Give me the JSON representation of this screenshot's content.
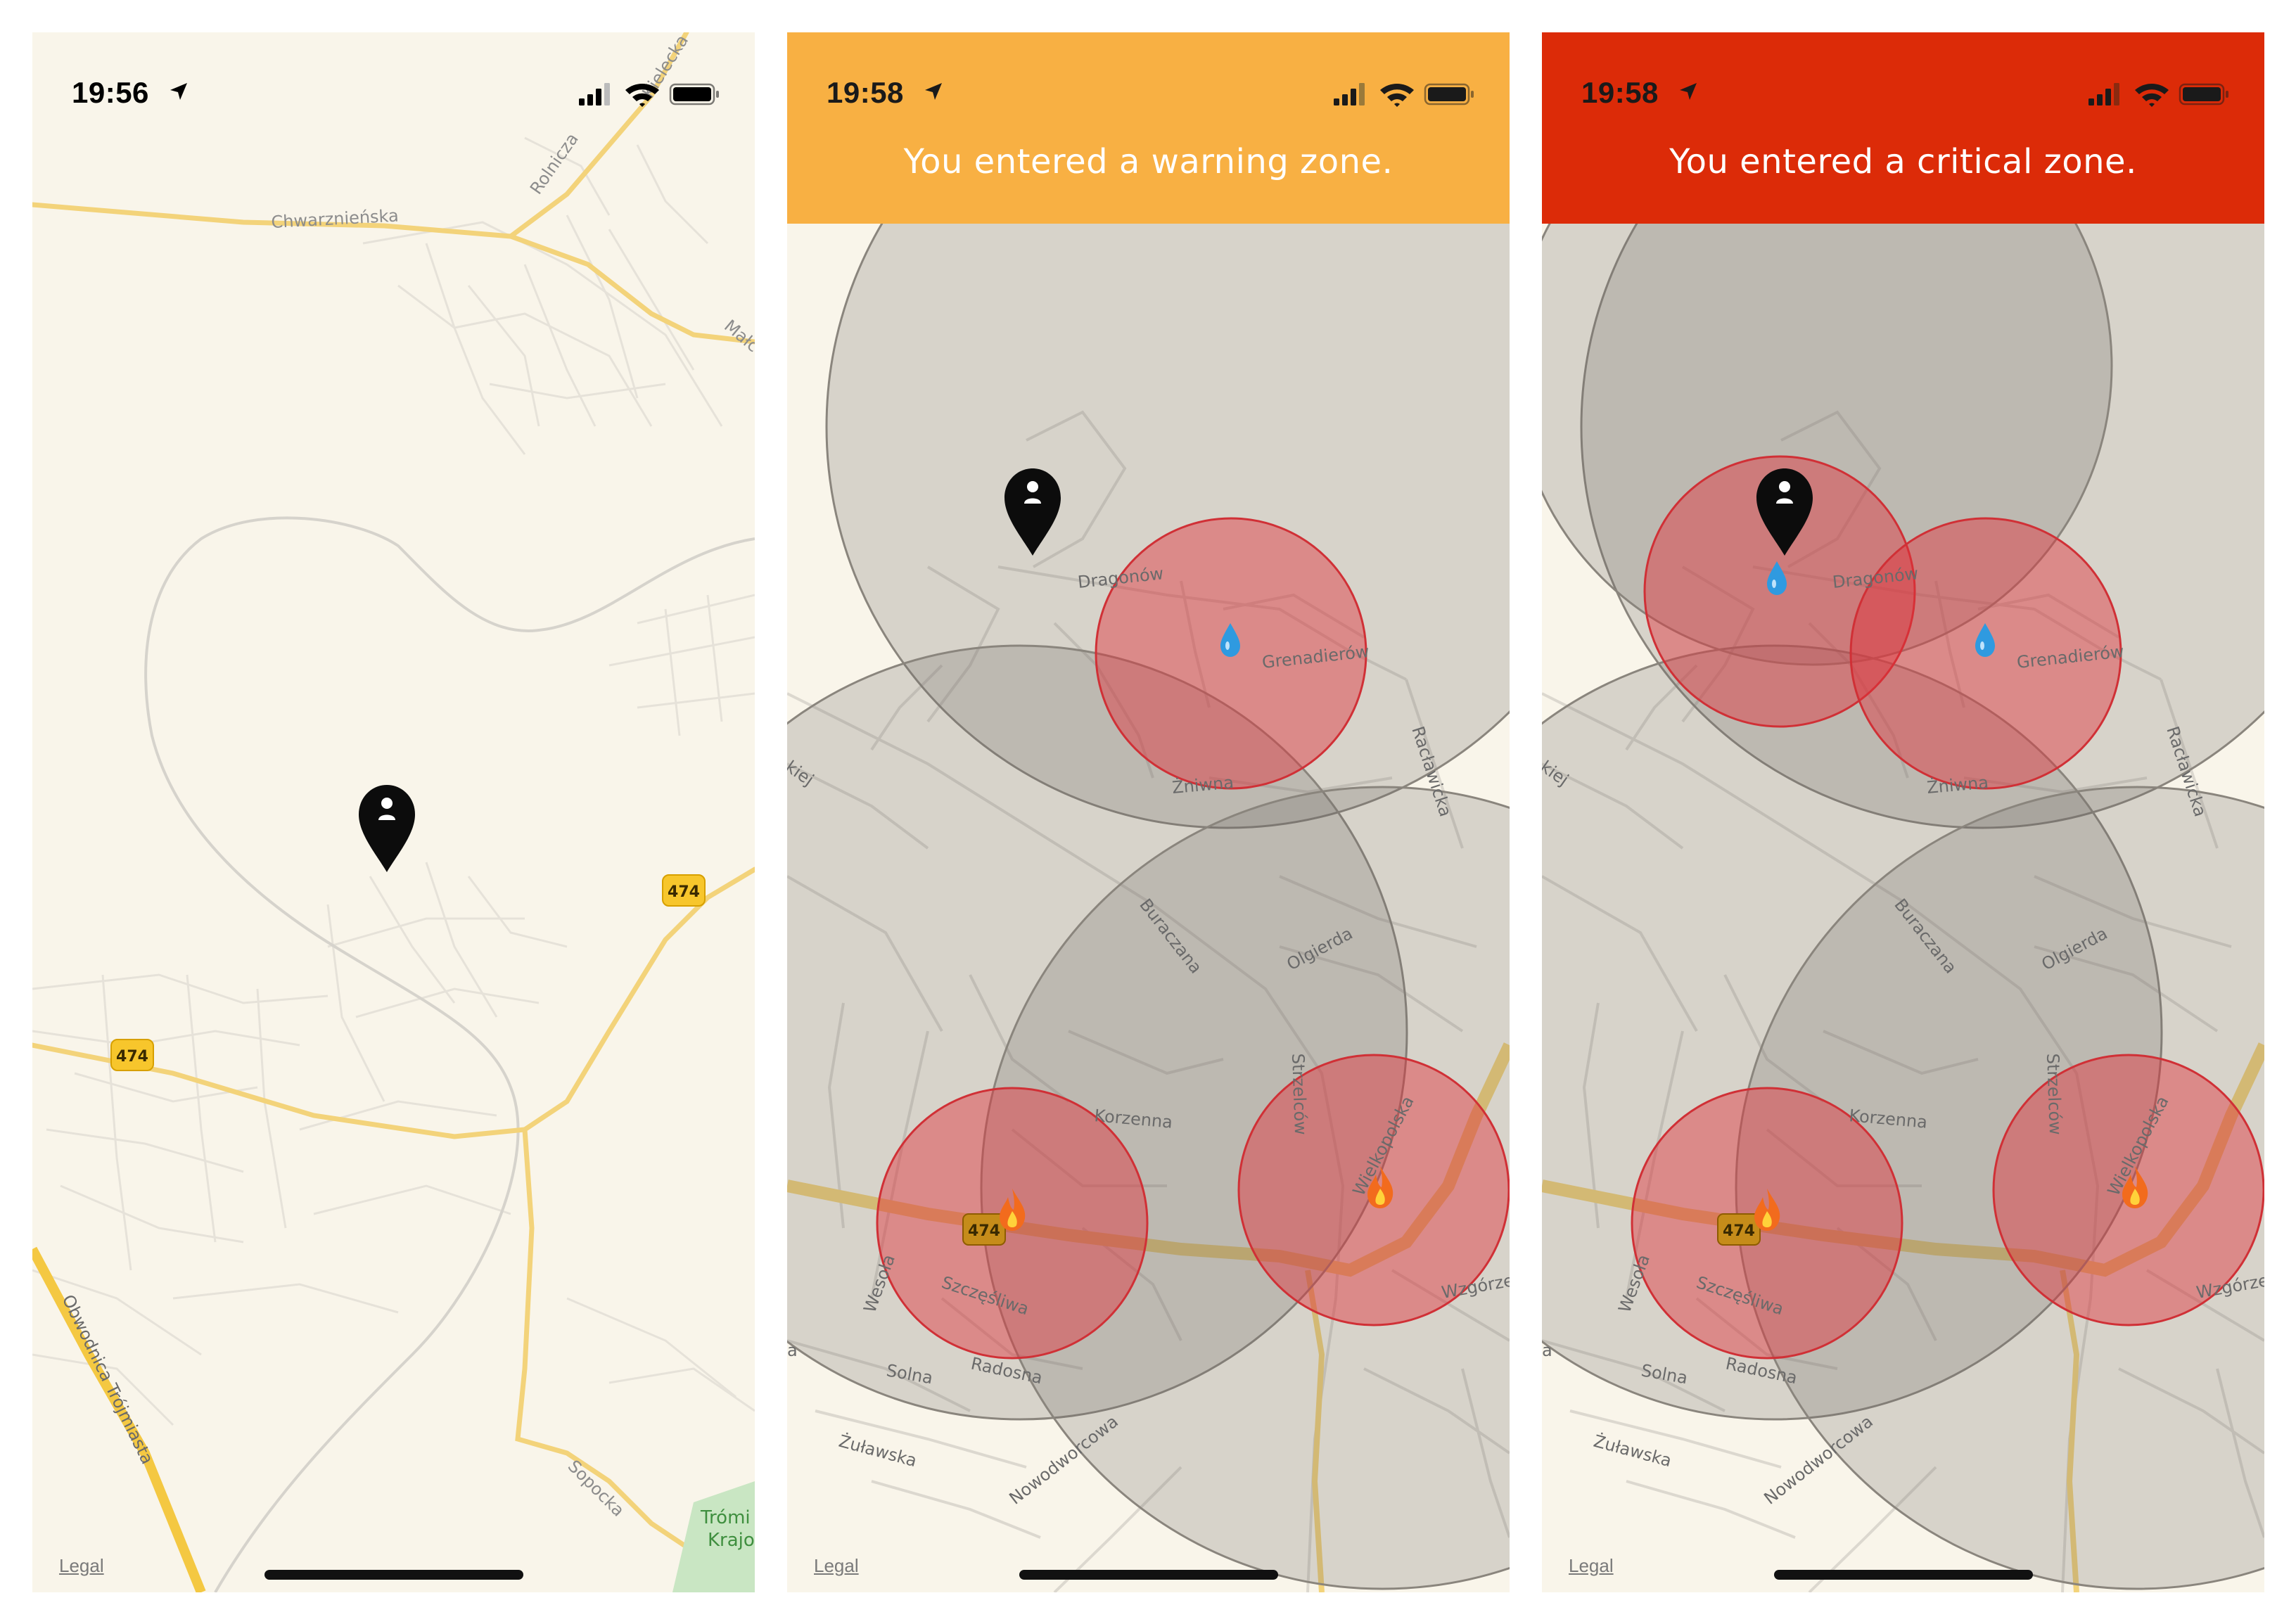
{
  "colors": {
    "map_background": "#f9f5ea",
    "warning_banner": "#f8b043",
    "critical_banner": "#dc2b08",
    "zone_gray": "#6e6a63",
    "zone_red": "#e0313a",
    "road_yellow": "#f3d37a",
    "highway_yellow": "#f4c842"
  },
  "screens": [
    {
      "status": {
        "time": "19:56",
        "location_icon": "location-arrow-icon",
        "signal_icon": "cellular-signal-icon",
        "wifi_icon": "wifi-icon",
        "battery_icon": "battery-icon"
      },
      "banner": null,
      "map": {
        "user_pin_icon": "user-location-pin-icon",
        "road_labels": [
          "Chwarznieńska",
          "Rolnicza",
          "Kielecka",
          "Małc",
          "Obwodnica Trójmiasta",
          "Sopocka"
        ],
        "route_shields": [
          "474",
          "474"
        ],
        "park_label_line1": "Trómi",
        "park_label_line2": "Krajo",
        "legal": "Legal"
      }
    },
    {
      "status": {
        "time": "19:58",
        "location_icon": "location-arrow-icon",
        "signal_icon": "cellular-signal-icon",
        "wifi_icon": "wifi-icon",
        "battery_icon": "battery-icon"
      },
      "banner": {
        "text": "You entered a warning zone.",
        "level": "warning"
      },
      "map": {
        "user_pin_icon": "user-location-pin-icon",
        "road_labels": [
          "Dragonów",
          "Grenadierów",
          "Żniwna",
          "Racławicka",
          "Buraczana",
          "Olgierda",
          "Korzenna",
          "Strzelców",
          "Wielkopolska",
          "Szczęśliwa",
          "Wesoła",
          "Radosna",
          "Solna",
          "Żuławska",
          "Nowodworcowa",
          "Wzgórze",
          "kiej",
          "a"
        ],
        "route_shields": [
          "474"
        ],
        "zone_icons": [
          "water-drop-icon",
          "fire-icon",
          "fire-icon"
        ],
        "legal": "Legal"
      }
    },
    {
      "status": {
        "time": "19:58",
        "location_icon": "location-arrow-icon",
        "signal_icon": "cellular-signal-icon",
        "wifi_icon": "wifi-icon",
        "battery_icon": "battery-icon"
      },
      "banner": {
        "text": "You entered a critical zone.",
        "level": "critical"
      },
      "map": {
        "user_pin_icon": "user-location-pin-icon",
        "road_labels": [
          "Dragonów",
          "Grenadierów",
          "Żniwna",
          "Racławicka",
          "Buraczana",
          "Olgierda",
          "Korzenna",
          "Strzelców",
          "Wielkopolska",
          "Szczęśliwa",
          "Wesoła",
          "Radosna",
          "Solna",
          "Żuławska",
          "Nowodworcowa",
          "Wzgórze",
          "kiej",
          "a"
        ],
        "route_shields": [
          "474"
        ],
        "zone_icons": [
          "water-drop-icon",
          "water-drop-icon",
          "fire-icon",
          "fire-icon"
        ],
        "legal": "Legal"
      }
    }
  ]
}
